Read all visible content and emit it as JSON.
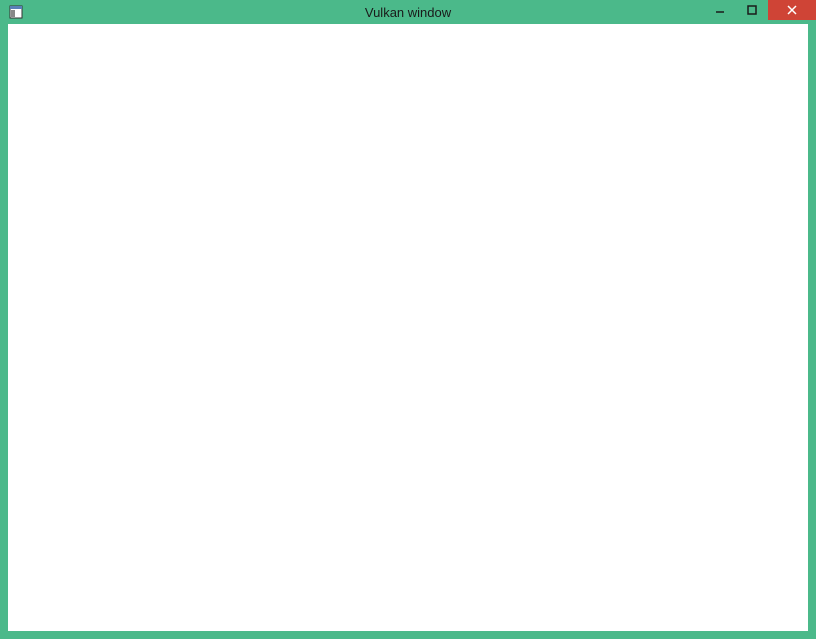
{
  "window": {
    "title": "Vulkan window"
  }
}
